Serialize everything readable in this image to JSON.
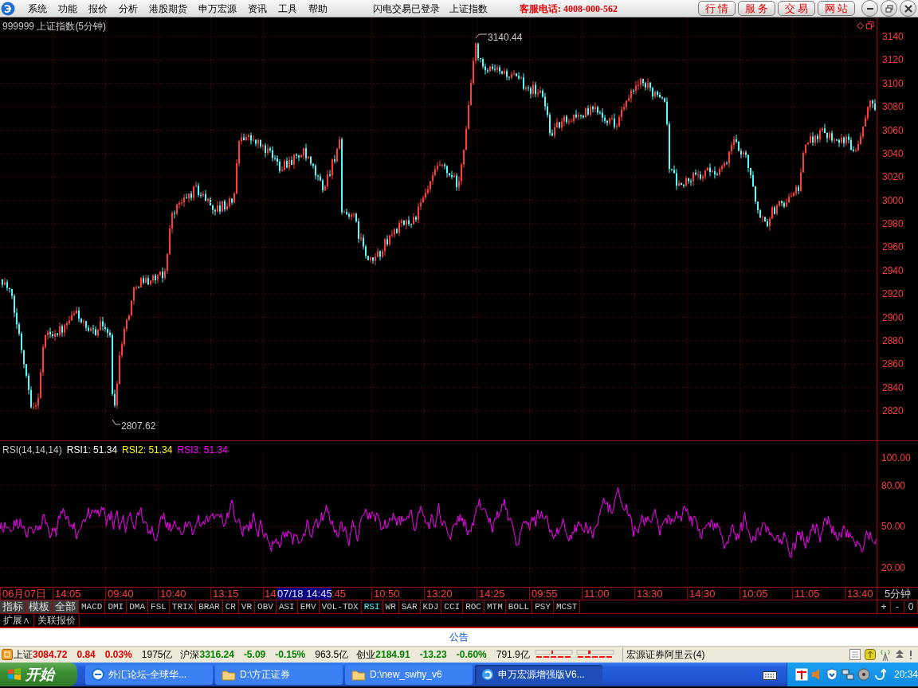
{
  "menu": {
    "items": [
      "系统",
      "功能",
      "报价",
      "分析",
      "港股期货",
      "申万宏源",
      "资讯",
      "工具",
      "帮助"
    ],
    "login_status": "闪电交易已登录",
    "current_index": "上证指数",
    "hotline": "客服电话: 4008-000-562",
    "buttons": [
      "行 情",
      "服 务",
      "交 易",
      "网 站"
    ]
  },
  "chart": {
    "title": "999999 上证指数(5分钟)",
    "y_ticks": [
      "3140",
      "3120",
      "3100",
      "3080",
      "3060",
      "3040",
      "3020",
      "3000",
      "2980",
      "2960",
      "2940",
      "2920",
      "2900",
      "2880",
      "2860",
      "2840",
      "2820"
    ],
    "high_label": "3140.44",
    "low_label": "2807.62"
  },
  "indicator": {
    "name": "RSI(14,14,14)",
    "values": [
      {
        "label": "RSI1: 51.34",
        "color": "#ffffff"
      },
      {
        "label": "RSI2: 51.34",
        "color": "#ffff00"
      },
      {
        "label": "RSI3: 51.34",
        "color": "#ff00ff"
      }
    ],
    "y_ticks": [
      "100.00",
      "80.00",
      "50.00",
      "20.00"
    ]
  },
  "time_axis": {
    "labels": [
      {
        "text": "06月07日",
        "kind": "label"
      },
      {
        "text": "14:05",
        "kind": "label"
      },
      {
        "text": "09:40",
        "kind": "label"
      },
      {
        "text": "10:40",
        "kind": "label"
      },
      {
        "text": "13:15",
        "kind": "label"
      },
      {
        "text": "14",
        "kind": "cut_start"
      },
      {
        "text": "07/18 14:45",
        "kind": "cursor"
      },
      {
        "text": ":45",
        "kind": "cut_end"
      },
      {
        "text": "10:50",
        "kind": "label"
      },
      {
        "text": "13:20",
        "kind": "label"
      },
      {
        "text": "14:25",
        "kind": "label"
      },
      {
        "text": "09:55",
        "kind": "label"
      },
      {
        "text": "11:00",
        "kind": "label"
      },
      {
        "text": "13:30",
        "kind": "label"
      },
      {
        "text": "14:30",
        "kind": "label"
      },
      {
        "text": "10:05",
        "kind": "label"
      },
      {
        "text": "11:05",
        "kind": "label"
      },
      {
        "text": "13:40",
        "kind": "label"
      }
    ],
    "period": "5分钟"
  },
  "menu_tabs": [
    "指标",
    "模板",
    "全部"
  ],
  "indicator_tabs": [
    {
      "label": "MACD",
      "selected": false
    },
    {
      "label": "DMI",
      "selected": false
    },
    {
      "label": "DMA",
      "selected": false
    },
    {
      "label": "FSL",
      "selected": false
    },
    {
      "label": "TRIX",
      "selected": false
    },
    {
      "label": "BRAR",
      "selected": false
    },
    {
      "label": "CR",
      "selected": false
    },
    {
      "label": "VR",
      "selected": false
    },
    {
      "label": "OBV",
      "selected": false
    },
    {
      "label": "ASI",
      "selected": false
    },
    {
      "label": "EMV",
      "selected": false
    },
    {
      "label": "VOL-TDX",
      "selected": false
    },
    {
      "label": "RSI",
      "selected": true
    },
    {
      "label": "WR",
      "selected": false
    },
    {
      "label": "SAR",
      "selected": false
    },
    {
      "label": "KDJ",
      "selected": false
    },
    {
      "label": "CCI",
      "selected": false
    },
    {
      "label": "ROC",
      "selected": false
    },
    {
      "label": "MTM",
      "selected": false
    },
    {
      "label": "BOLL",
      "selected": false
    },
    {
      "label": "PSY",
      "selected": false
    },
    {
      "label": "MCST",
      "selected": false
    }
  ],
  "zoom_buttons": [
    "+",
    "-",
    "0"
  ],
  "extra_tabs": [
    "扩展∧",
    "关联报价"
  ],
  "notice": "公告",
  "status_bar": {
    "markets": [
      {
        "name": "上证",
        "price": "3084.72",
        "change": "0.84",
        "percent": "0.03%",
        "volume": "1975亿",
        "kind": "up"
      },
      {
        "name": "沪深",
        "price": "3316.24",
        "change": "-5.09",
        "percent": "-0.15%",
        "volume": "963.5亿",
        "kind": "down"
      },
      {
        "name": "创业",
        "price": "2184.91",
        "change": "-13.23",
        "percent": "-0.60%",
        "volume": "791.9亿",
        "kind": "down"
      }
    ],
    "server": "宏源证券阿里云(4)"
  },
  "taskbar": {
    "start": "开始",
    "tasks": [
      {
        "label": "外汇论坛-全球华...",
        "kind": "browser",
        "selected": false
      },
      {
        "label": "D:\\方正证券",
        "kind": "folder",
        "selected": false
      },
      {
        "label": "D:\\new_swhy_v6",
        "kind": "folder",
        "selected": false
      },
      {
        "label": "申万宏源增强版V6...",
        "kind": "app",
        "selected": true
      }
    ],
    "clock": "20:34"
  }
}
